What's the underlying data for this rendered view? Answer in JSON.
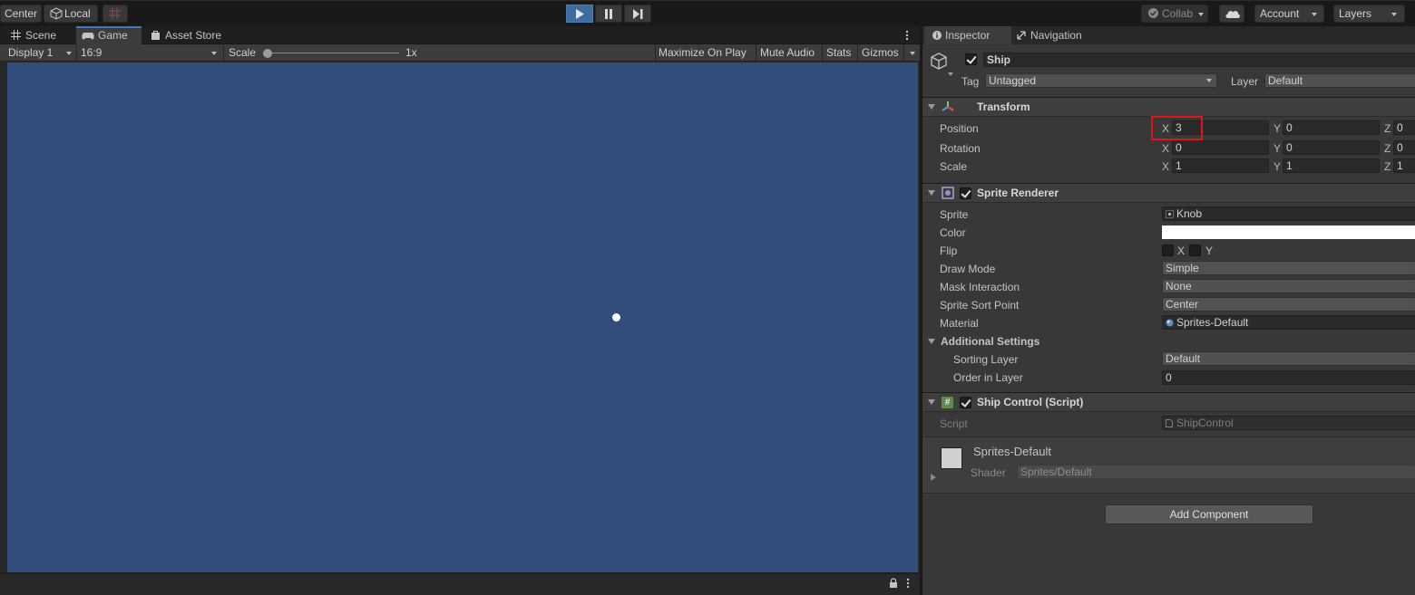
{
  "toolbar": {
    "pivot": "Center",
    "space": "Local",
    "collab": "Collab",
    "account": "Account",
    "layers": "Layers"
  },
  "game_panel": {
    "tabs": [
      {
        "label": "Scene",
        "icon": "grid-icon"
      },
      {
        "label": "Game",
        "icon": "gamepad-icon"
      },
      {
        "label": "Asset Store",
        "icon": "bag-icon"
      }
    ],
    "display": "Display 1",
    "aspect": "16:9",
    "scale_label": "Scale",
    "scale_value": "1x",
    "maximize": "Maximize On Play",
    "mute": "Mute Audio",
    "stats": "Stats",
    "gizmos": "Gizmos",
    "background_color": "#314d79"
  },
  "inspector": {
    "tabs": [
      {
        "label": "Inspector",
        "icon": "info-icon"
      },
      {
        "label": "Navigation",
        "icon": "navigation-icon"
      }
    ],
    "object": {
      "name": "Ship",
      "tag_label": "Tag",
      "tag": "Untagged",
      "layer_label": "Layer",
      "layer": "Default"
    },
    "transform": {
      "title": "Transform",
      "position": {
        "label": "Position",
        "x": "3",
        "y": "0",
        "z": "0"
      },
      "rotation": {
        "label": "Rotation",
        "x": "0",
        "y": "0",
        "z": "0"
      },
      "scale": {
        "label": "Scale",
        "x": "1",
        "y": "1",
        "z": "1"
      }
    },
    "sprite_renderer": {
      "title": "Sprite Renderer",
      "sprite_label": "Sprite",
      "sprite": "Knob",
      "color_label": "Color",
      "flip_label": "Flip",
      "flip_x": "X",
      "flip_y": "Y",
      "draw_mode_label": "Draw Mode",
      "draw_mode": "Simple",
      "mask_label": "Mask Interaction",
      "mask": "None",
      "sort_point_label": "Sprite Sort Point",
      "sort_point": "Center",
      "material_label": "Material",
      "material": "Sprites-Default",
      "additional_label": "Additional Settings",
      "sorting_layer_label": "Sorting Layer",
      "sorting_layer": "Default",
      "order_label": "Order in Layer",
      "order": "0"
    },
    "ship_control": {
      "title": "Ship Control (Script)",
      "script_label": "Script",
      "script": "ShipControl"
    },
    "material_preview": {
      "name": "Sprites-Default",
      "shader_label": "Shader",
      "shader": "Sprites/Default"
    },
    "add_component": "Add Component"
  }
}
